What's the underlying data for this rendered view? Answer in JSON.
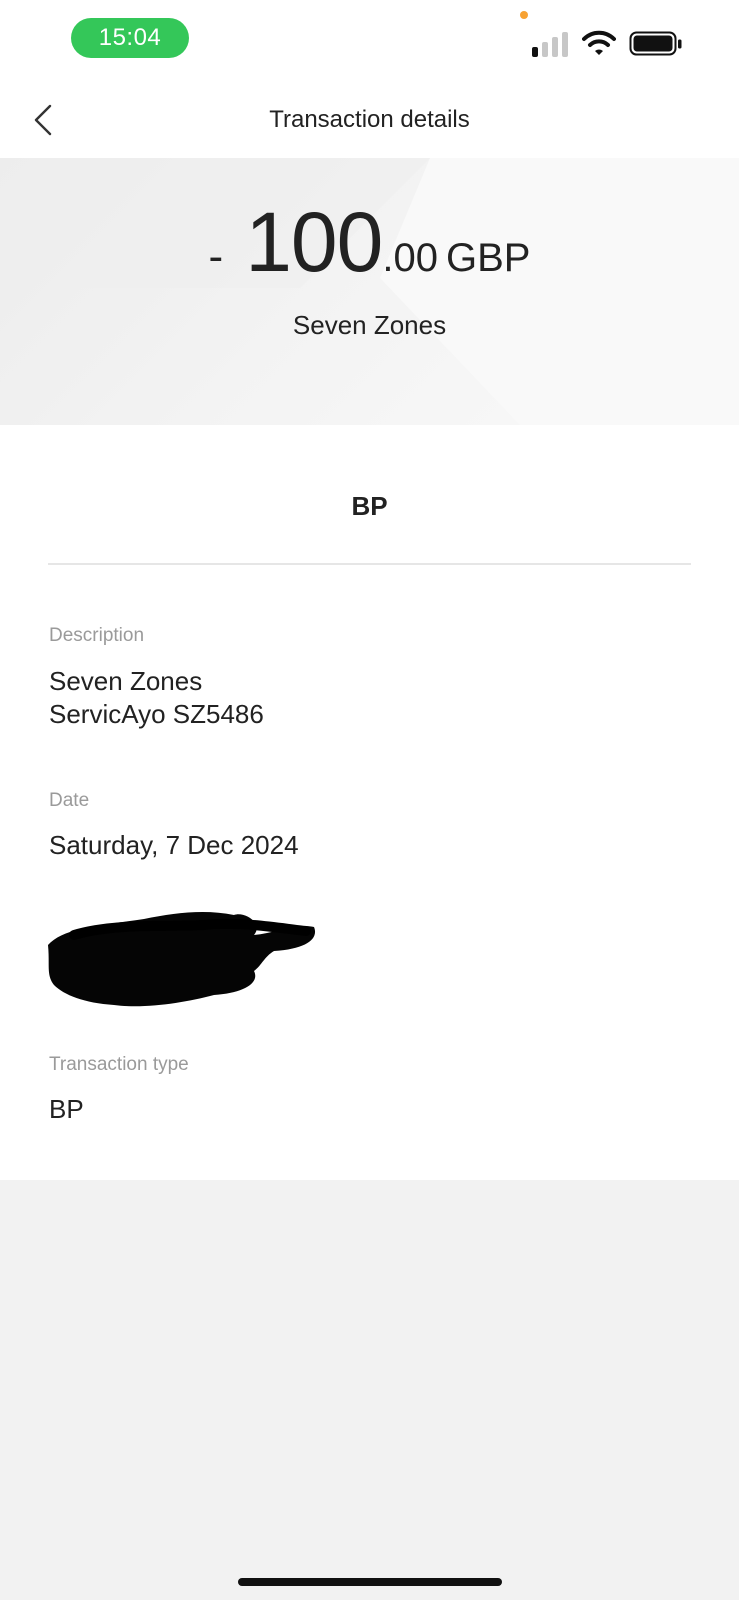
{
  "status_bar": {
    "time": "15:04",
    "signal_bars_active": 1,
    "signal_bars_total": 4,
    "privacy_indicator_color": "#f7a233"
  },
  "nav": {
    "back_icon": "chevron-left-icon",
    "title": "Transaction details"
  },
  "transaction": {
    "amount": {
      "sign": "-",
      "integer": "100",
      "decimals": ".00",
      "currency": "GBP"
    },
    "merchant": "Seven Zones",
    "category": "BP"
  },
  "fields": {
    "description_label": "Description",
    "description_line1": "Seven Zones",
    "description_line2": "ServicAyo SZ5486",
    "date_label": "Date",
    "date_value": "Saturday, 7 Dec 2024",
    "transaction_type_label": "Transaction type",
    "transaction_type_value": "BP"
  },
  "colors": {
    "status_pill": "#34c759",
    "background": "#f2f2f2",
    "card": "#ffffff",
    "text": "#222222",
    "label": "#9a9a9a"
  }
}
